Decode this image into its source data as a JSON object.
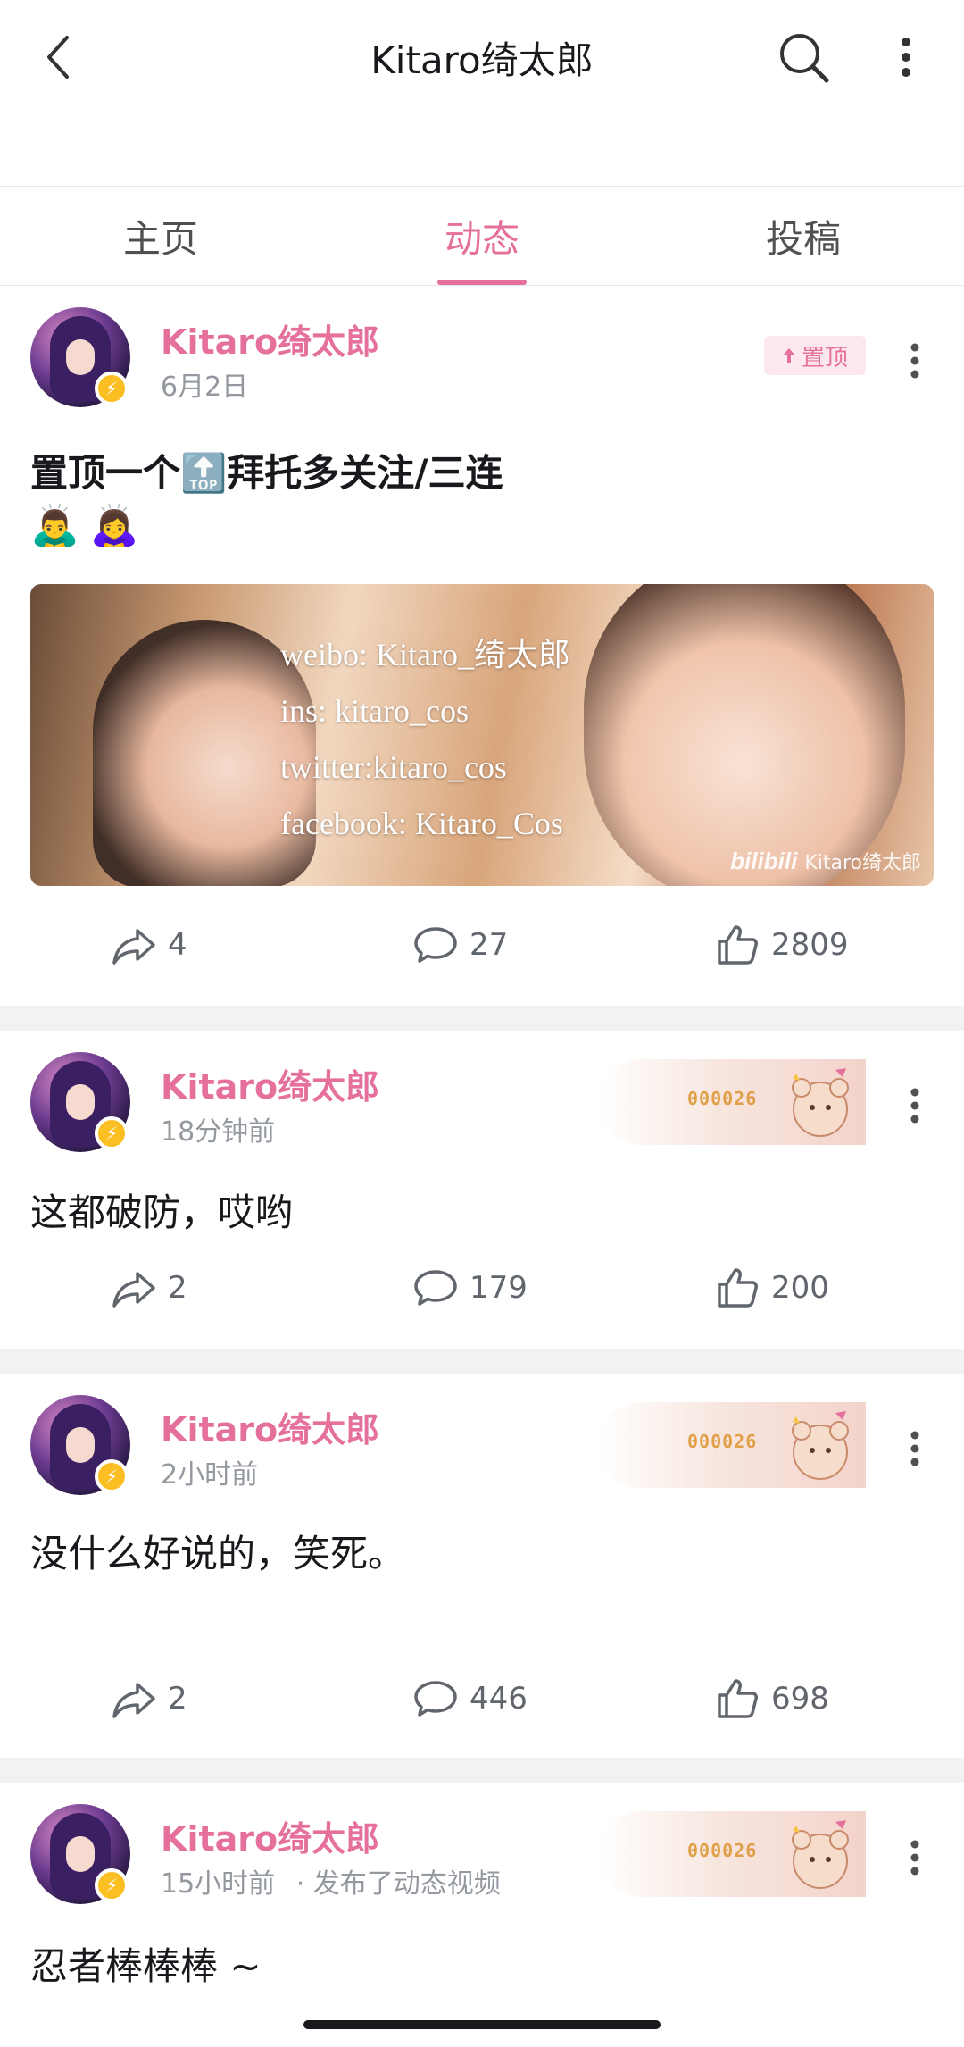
{
  "header": {
    "title": "Kitaro绮太郎",
    "back_icon": "chevron-left-icon",
    "search_icon": "search-icon",
    "more_icon": "more-vertical-icon"
  },
  "tabs": [
    {
      "label": "主页",
      "active": false
    },
    {
      "label": "动态",
      "active": true
    },
    {
      "label": "投稿",
      "active": false
    }
  ],
  "accent_color": "#e5709b",
  "posts": [
    {
      "author": "Kitaro绮太郎",
      "time": "6月2日",
      "pinned_label": "置顶",
      "text": "置顶一个🔝拜托多关注/三连",
      "emojis": [
        "🙇‍♂️",
        "🙇‍♀️"
      ],
      "image": {
        "lines": [
          "weibo: Kitaro_绮太郎",
          "ins: kitaro_cos",
          "twitter:kitaro_cos",
          "facebook: Kitaro_Cos"
        ],
        "watermark_brand": "bilibili",
        "watermark_user": "Kitaro绮太郎"
      },
      "shares": "4",
      "comments": "27",
      "likes": "2809"
    },
    {
      "author": "Kitaro绮太郎",
      "time": "18分钟前",
      "badge_number": "000026",
      "text": "这都破防，哎哟",
      "shares": "2",
      "comments": "179",
      "likes": "200"
    },
    {
      "author": "Kitaro绮太郎",
      "time": "2小时前",
      "badge_number": "000026",
      "text": "没什么好说的，笑死。",
      "shares": "2",
      "comments": "446",
      "likes": "698"
    },
    {
      "author": "Kitaro绮太郎",
      "time": "15小时前",
      "time_suffix": "· 发布了动态视频",
      "badge_number": "000026",
      "text": "忍者棒棒棒 ~"
    }
  ]
}
